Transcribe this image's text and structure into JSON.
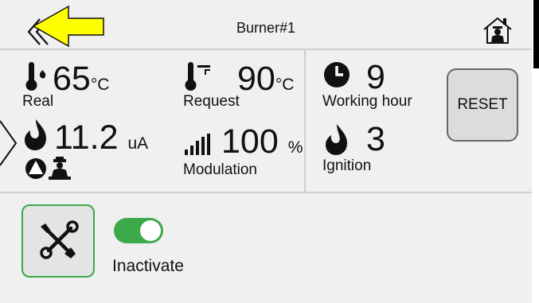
{
  "header": {
    "title": "Burner#1",
    "back_icon": "double-chevron-left-icon",
    "home_icon": "home-chimney-sweep-icon",
    "highlight_arrow_color": "#ffff00"
  },
  "stats": {
    "real": {
      "value": "65",
      "unit": "°C",
      "label": "Real",
      "icon": "thermometer-flame-icon"
    },
    "request": {
      "value": "90",
      "unit": "°C",
      "label": "Request",
      "icon": "thermometer-radiator-icon"
    },
    "flame": {
      "value": "11.2",
      "unit": "uA",
      "icon": "flame-icon"
    },
    "modulation": {
      "value": "100",
      "unit": "%",
      "label": "Modulation",
      "icon": "signal-bars-icon"
    },
    "working_hour": {
      "value": "9",
      "label": "Working hour",
      "icon": "clock-icon"
    },
    "ignition": {
      "value": "3",
      "label": "Ignition",
      "icon": "flame-icon"
    }
  },
  "reset_button": {
    "label": "RESET"
  },
  "controls": {
    "tools_icon": "wrench-screwdriver-icon",
    "toggle_state": "on",
    "toggle_label": "Inactivate"
  },
  "colors": {
    "accent_green": "#3da948",
    "background": "#f0f0f0"
  }
}
